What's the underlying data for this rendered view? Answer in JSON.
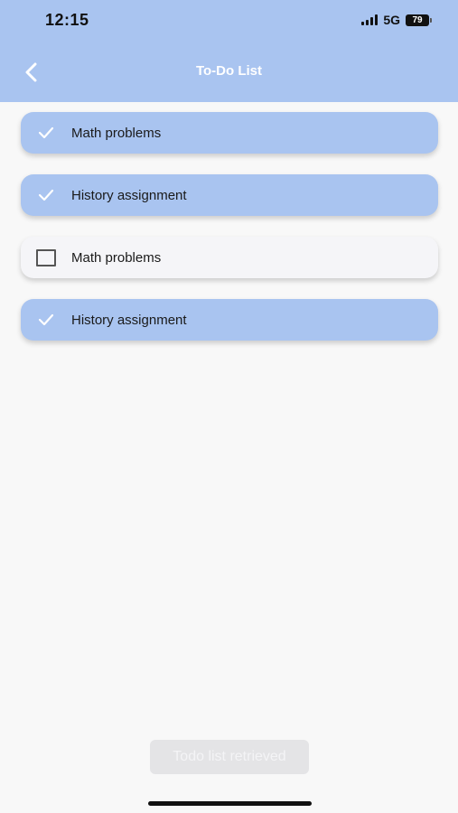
{
  "status_bar": {
    "time": "12:15",
    "network": "5G",
    "battery": "79"
  },
  "header": {
    "title": "To-Do List",
    "back_icon": "chevron-left-icon"
  },
  "todos": [
    {
      "label": "Math problems",
      "checked": true
    },
    {
      "label": "History assignment",
      "checked": true
    },
    {
      "label": "Math problems",
      "checked": false
    },
    {
      "label": "History assignment",
      "checked": true
    }
  ],
  "toast": {
    "message": "Todo list retrieved"
  },
  "colors": {
    "header_bg": "#a9c4f0",
    "done_item_bg": "#a9c4f0",
    "open_item_bg": "#f5f5f8",
    "page_bg": "#f8f8f8"
  }
}
